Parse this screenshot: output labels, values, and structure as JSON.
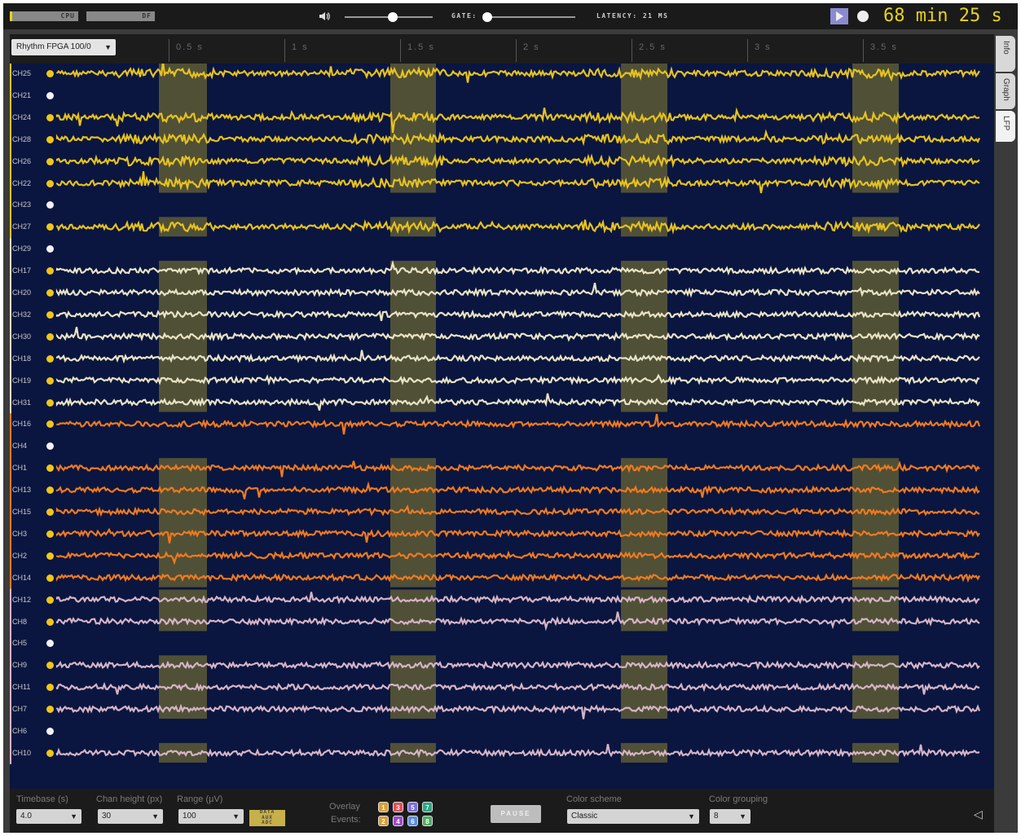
{
  "top": {
    "cpu_label": "CPU",
    "df_label": "DF",
    "gate_label": "GATE:",
    "latency_label": "LATENCY: 21 MS",
    "clock_text": "68 min 25 s",
    "volume_level": 0.55,
    "gate_level": 0.0
  },
  "source": {
    "label": "Rhythm FPGA 100/0",
    "arrow": "▼"
  },
  "timescale": [
    "0.5 s",
    "1 s",
    "1.5 s",
    "2 s",
    "2.5 s",
    "3 s",
    "3.5 s"
  ],
  "tabs": [
    "Info",
    "Graph",
    "LFP"
  ],
  "channels": [
    {
      "name": "CH25",
      "group": "yellow",
      "active": true
    },
    {
      "name": "CH21",
      "group": "yellow",
      "active": false
    },
    {
      "name": "CH24",
      "group": "yellow",
      "active": true
    },
    {
      "name": "CH28",
      "group": "yellow",
      "active": true
    },
    {
      "name": "CH26",
      "group": "yellow",
      "active": true
    },
    {
      "name": "CH22",
      "group": "yellow",
      "active": true
    },
    {
      "name": "CH23",
      "group": "yellow",
      "active": false
    },
    {
      "name": "CH27",
      "group": "yellow",
      "active": true
    },
    {
      "name": "CH29",
      "group": "cream",
      "active": false
    },
    {
      "name": "CH17",
      "group": "cream",
      "active": true
    },
    {
      "name": "CH20",
      "group": "cream",
      "active": true
    },
    {
      "name": "CH32",
      "group": "cream",
      "active": true
    },
    {
      "name": "CH30",
      "group": "cream",
      "active": true
    },
    {
      "name": "CH18",
      "group": "cream",
      "active": true
    },
    {
      "name": "CH19",
      "group": "cream",
      "active": true
    },
    {
      "name": "CH31",
      "group": "cream",
      "active": true
    },
    {
      "name": "CH16",
      "group": "orange",
      "active": true
    },
    {
      "name": "CH4",
      "group": "orange",
      "active": false
    },
    {
      "name": "CH1",
      "group": "orange",
      "active": true
    },
    {
      "name": "CH13",
      "group": "orange",
      "active": true
    },
    {
      "name": "CH15",
      "group": "orange",
      "active": true
    },
    {
      "name": "CH3",
      "group": "orange",
      "active": true
    },
    {
      "name": "CH2",
      "group": "orange",
      "active": true
    },
    {
      "name": "CH14",
      "group": "orange",
      "active": true
    },
    {
      "name": "CH12",
      "group": "pink",
      "active": true
    },
    {
      "name": "CH8",
      "group": "pink",
      "active": true
    },
    {
      "name": "CH5",
      "group": "pink",
      "active": false
    },
    {
      "name": "CH9",
      "group": "pink",
      "active": true
    },
    {
      "name": "CH11",
      "group": "pink",
      "active": true
    },
    {
      "name": "CH7",
      "group": "pink",
      "active": true
    },
    {
      "name": "CH6",
      "group": "pink",
      "active": false
    },
    {
      "name": "CH10",
      "group": "pink",
      "active": true
    }
  ],
  "group_colors": {
    "yellow": "#e6c21e",
    "cream": "#e9e3c4",
    "orange": "#f07a1e",
    "pink": "#d6b4c6"
  },
  "event_color": "#8a8230",
  "bottom": {
    "timebase_label": "Timebase (s)",
    "timebase_value": "4.0",
    "chan_height_label": "Chan height (px)",
    "chan_height_value": "30",
    "range_label": "Range (µV)",
    "range_value": "100",
    "gate_box": [
      "DATA",
      "AUX",
      "ADC"
    ],
    "overlay_label": "Overlay",
    "events_label": "Events:",
    "event_buttons": [
      "1",
      "3",
      "5",
      "7",
      "2",
      "4",
      "6",
      "8"
    ],
    "event_button_colors": [
      "#d9a03a",
      "#e0505a",
      "#7c70d8",
      "#2ca880",
      "#d9a03a",
      "#a04cc8",
      "#5b8fe0",
      "#4cb060"
    ],
    "pause_label": "PAUSE",
    "color_scheme_label": "Color scheme",
    "color_scheme_value": "Classic",
    "color_grouping_label": "Color grouping",
    "color_grouping_value": "8",
    "arrow": "▼",
    "collapse_icon": "◁"
  }
}
